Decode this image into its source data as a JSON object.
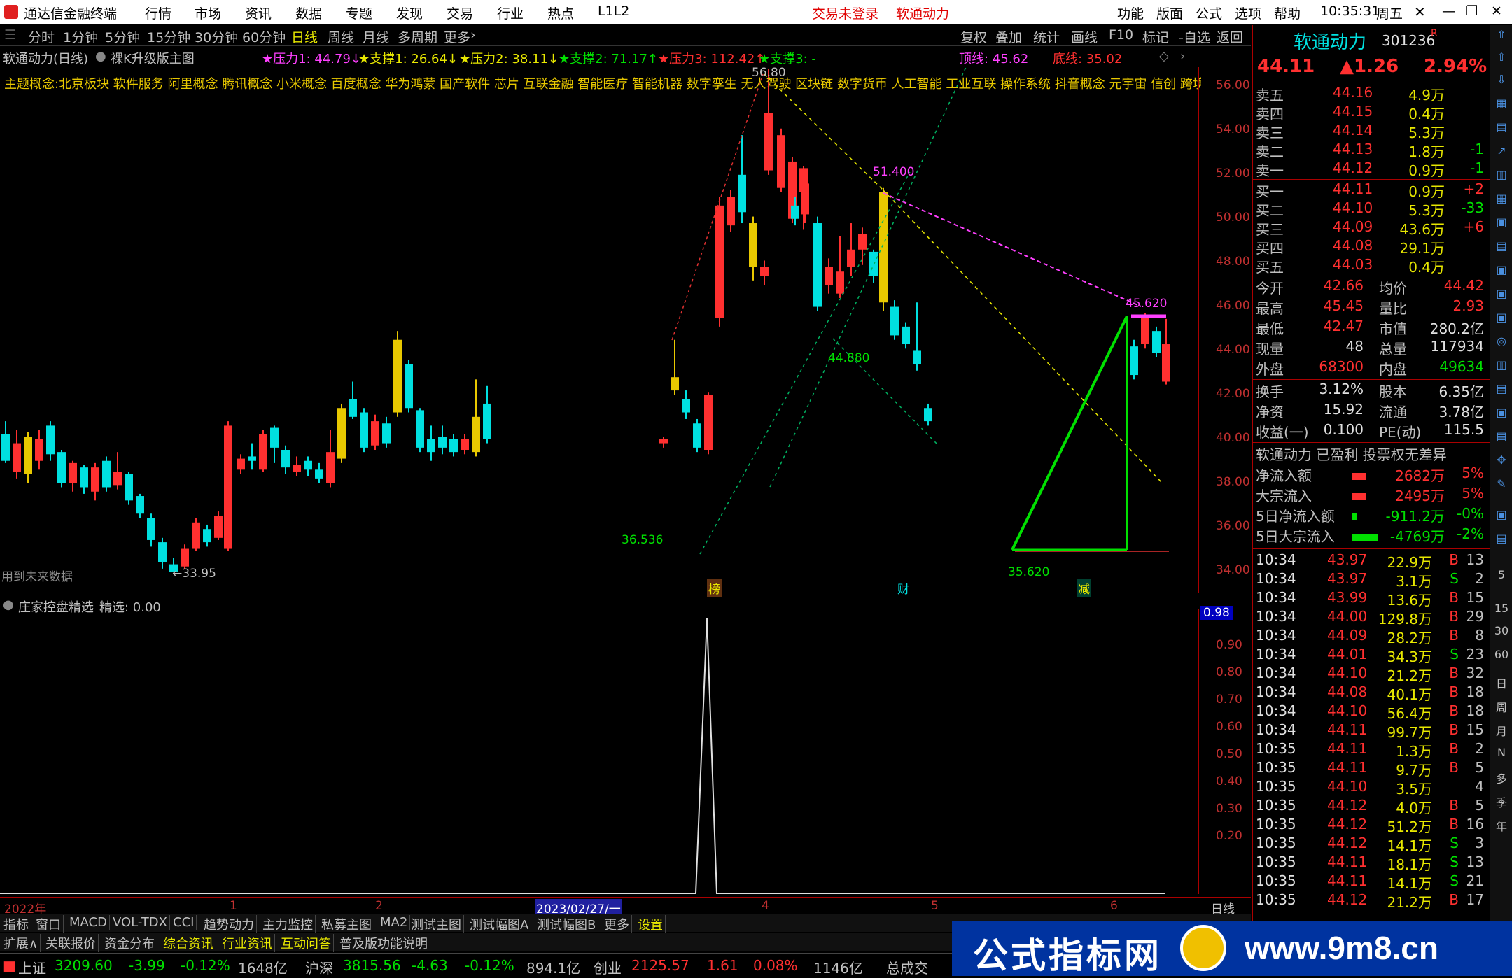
{
  "titlebar": {
    "app_name": "通达信金融终端",
    "menu": [
      "行情",
      "市场",
      "资讯",
      "数据",
      "专题",
      "发现",
      "交易",
      "行业",
      "热点",
      "L1L2"
    ],
    "login_status": "交易未登录",
    "stock_name": "软通动力",
    "right_menu": [
      "功能",
      "版面",
      "公式",
      "选项",
      "帮助"
    ],
    "time": "10:35:31",
    "weekday": "周五"
  },
  "periodbar": {
    "periods": [
      "分时",
      "1分钟",
      "5分钟",
      "15分钟",
      "30分钟",
      "60分钟",
      "日线",
      "周线",
      "月线",
      "多周期",
      "更多"
    ],
    "active": "日线",
    "tools": [
      "复权",
      "叠加",
      "统计",
      "画线",
      "F10",
      "标记",
      "-自选",
      "返回"
    ]
  },
  "chartinfo": {
    "title": "软通动力(日线)",
    "template": "裸K升级版主图",
    "indicators": [
      "★压力1: 44.79↓",
      "★支撑1: 26.64↓",
      "★压力2: 38.11↓",
      "★支撑2: 71.17↑",
      "★压力3: 112.42↑",
      "★支撑3: -"
    ],
    "top_line": "顶线: 45.62",
    "bottom_line": "底线: 35.02"
  },
  "concepts": "主题概念:北京板块 软件服务 阿里概念 腾讯概念 小米概念 百度概念 华为鸿蒙 国产软件 芯片 互联金融 智能医疗 智能机器 数字孪生 无人驾驶 区块链 数字货币 人工智能 工业互联 操作系统 抖音概念 元宇宙 信创 跨境支付",
  "main_axis": [
    "56.00",
    "54.00",
    "52.00",
    "50.00",
    "48.00",
    "46.00",
    "44.00",
    "42.00",
    "40.00",
    "38.00",
    "36.00",
    "34.00"
  ],
  "annotations": {
    "high": "56.80",
    "peak2": "51.400",
    "low_mid": "44.880",
    "low1": "36.536",
    "low2": "35.620",
    "right_top": "45.620",
    "low_left": "←33.95",
    "future": "用到未来数据",
    "marker_bang": "榜",
    "marker_cai": "财",
    "marker_jian": "减"
  },
  "subchart": {
    "title": "庄家控盘精选",
    "value_label": "精选: 0.00",
    "current": "0.98",
    "axis": [
      "0.90",
      "0.80",
      "0.70",
      "0.60",
      "0.50",
      "0.40",
      "0.30",
      "0.20"
    ]
  },
  "dateaxis": {
    "labels": [
      "2022年",
      "1",
      "2",
      "2023/02/27/一",
      "4",
      "5",
      "6"
    ],
    "period": "日线"
  },
  "tabs1": [
    "指标",
    "窗口",
    "MACD",
    "VOL-TDX",
    "CCI",
    "趋势动力",
    "主力监控",
    "私募主图",
    "MA2",
    "测试主图",
    "测试幅图A",
    "测试幅图B",
    "更多",
    "设置"
  ],
  "tabs2": [
    "扩展∧",
    "关联报价",
    "资金分布",
    "综合资讯",
    "行业资讯",
    "互动问答",
    "普及版功能说明"
  ],
  "statusbar": {
    "sh_label": "上证",
    "sh_val": "3209.60",
    "sh_chg": "-3.99",
    "sh_pct": "-0.12%",
    "sh_amt": "1648亿",
    "hs_label": "沪深",
    "hs_val": "3815.56",
    "hs_chg": "-4.63",
    "hs_pct": "-0.12%",
    "hs_amt": "894.1亿",
    "cy_label": "创业",
    "cy_val": "2125.57",
    "cy_chg": "1.61",
    "cy_pct": "0.08%",
    "cy_amt": "1146亿",
    "total_label": "总成交"
  },
  "quote": {
    "name": "软通动力",
    "code": "301236",
    "r": "R",
    "price": "44.11",
    "change": "▲1.26",
    "pct": "2.94%",
    "asks": [
      {
        "label": "卖五",
        "price": "44.16",
        "vol": "4.9万",
        "chg": ""
      },
      {
        "label": "卖四",
        "price": "44.15",
        "vol": "0.4万",
        "chg": ""
      },
      {
        "label": "卖三",
        "price": "44.14",
        "vol": "5.3万",
        "chg": ""
      },
      {
        "label": "卖二",
        "price": "44.13",
        "vol": "1.8万",
        "chg": "-1"
      },
      {
        "label": "卖一",
        "price": "44.12",
        "vol": "0.9万",
        "chg": "-1"
      }
    ],
    "bids": [
      {
        "label": "买一",
        "price": "44.11",
        "vol": "0.9万",
        "chg": "+2"
      },
      {
        "label": "买二",
        "price": "44.10",
        "vol": "5.3万",
        "chg": "-33"
      },
      {
        "label": "买三",
        "price": "44.09",
        "vol": "43.6万",
        "chg": "+6"
      },
      {
        "label": "买四",
        "price": "44.08",
        "vol": "29.1万",
        "chg": ""
      },
      {
        "label": "买五",
        "price": "44.03",
        "vol": "0.4万",
        "chg": ""
      }
    ],
    "stats": [
      {
        "l1": "今开",
        "v1": "42.66",
        "l2": "均价",
        "v2": "44.42"
      },
      {
        "l1": "最高",
        "v1": "45.45",
        "l2": "量比",
        "v2": "2.93"
      },
      {
        "l1": "最低",
        "v1": "42.47",
        "l2": "市值",
        "v2": "280.2亿"
      },
      {
        "l1": "现量",
        "v1": "48",
        "l2": "总量",
        "v2": "117934"
      },
      {
        "l1": "外盘",
        "v1": "68300",
        "l2": "内盘",
        "v2": "49634"
      }
    ],
    "stats2": [
      {
        "l1": "换手",
        "v1": "3.12%",
        "l2": "股本",
        "v2": "6.35亿"
      },
      {
        "l1": "净资",
        "v1": "15.92",
        "l2": "流通",
        "v2": "3.78亿"
      },
      {
        "l1": "收益(一)",
        "v1": "0.100",
        "l2": "PE(动)",
        "v2": "115.5"
      }
    ],
    "status_line": "软通动力 已盈利 投票权无差异",
    "flows": [
      {
        "label": "净流入额",
        "val": "2682万",
        "pct": "5%",
        "color": "#ff3030"
      },
      {
        "label": "大宗流入",
        "val": "2495万",
        "pct": "5%",
        "color": "#ff3030"
      },
      {
        "label": "5日净流入额",
        "val": "-911.2万",
        "pct": "-0%",
        "color": "#00e000"
      },
      {
        "label": "5日大宗流入",
        "val": "-4769万",
        "pct": "-2%",
        "color": "#00e000"
      }
    ],
    "ticks": [
      {
        "t": "10:34",
        "p": "43.97",
        "v": "22.9万",
        "d": "B",
        "n": "13"
      },
      {
        "t": "10:34",
        "p": "43.97",
        "v": "3.1万",
        "d": "S",
        "n": "2"
      },
      {
        "t": "10:34",
        "p": "43.99",
        "v": "13.6万",
        "d": "B",
        "n": "15"
      },
      {
        "t": "10:34",
        "p": "44.00",
        "v": "129.8万",
        "d": "B",
        "n": "29"
      },
      {
        "t": "10:34",
        "p": "44.09",
        "v": "28.2万",
        "d": "B",
        "n": "8"
      },
      {
        "t": "10:34",
        "p": "44.01",
        "v": "34.3万",
        "d": "S",
        "n": "23"
      },
      {
        "t": "10:34",
        "p": "44.10",
        "v": "21.2万",
        "d": "B",
        "n": "32"
      },
      {
        "t": "10:34",
        "p": "44.08",
        "v": "40.1万",
        "d": "B",
        "n": "18"
      },
      {
        "t": "10:34",
        "p": "44.10",
        "v": "56.4万",
        "d": "B",
        "n": "18"
      },
      {
        "t": "10:34",
        "p": "44.11",
        "v": "99.7万",
        "d": "B",
        "n": "15"
      },
      {
        "t": "10:35",
        "p": "44.11",
        "v": "1.3万",
        "d": "B",
        "n": "2"
      },
      {
        "t": "10:35",
        "p": "44.11",
        "v": "9.7万",
        "d": "B",
        "n": "5"
      },
      {
        "t": "10:35",
        "p": "44.10",
        "v": "3.5万",
        "d": "",
        "n": "4"
      },
      {
        "t": "10:35",
        "p": "44.12",
        "v": "4.0万",
        "d": "B",
        "n": "5"
      },
      {
        "t": "10:35",
        "p": "44.12",
        "v": "51.2万",
        "d": "B",
        "n": "16"
      },
      {
        "t": "10:35",
        "p": "44.12",
        "v": "14.1万",
        "d": "S",
        "n": "3"
      },
      {
        "t": "10:35",
        "p": "44.11",
        "v": "18.1万",
        "d": "S",
        "n": "13"
      },
      {
        "t": "10:35",
        "p": "44.11",
        "v": "14.1万",
        "d": "S",
        "n": "21"
      },
      {
        "t": "10:35",
        "p": "44.12",
        "v": "21.2万",
        "d": "B",
        "n": "17"
      }
    ]
  },
  "toolstrip": [
    "日",
    "周",
    "月",
    "N",
    "多",
    "季",
    "年"
  ],
  "toolstrip_nums": [
    "5",
    "15",
    "30",
    "60"
  ],
  "watermark": {
    "text": "公式指标网",
    "url": "www.9m8.cn"
  },
  "colors": {
    "up": "#ff3030",
    "down": "#00e0e0",
    "accent": "#e8e800",
    "brand": "#0033a0"
  }
}
